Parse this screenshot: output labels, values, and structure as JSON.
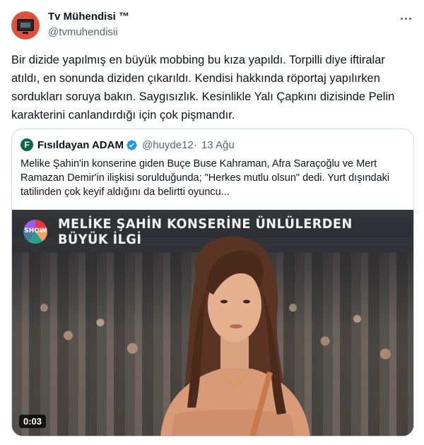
{
  "author": {
    "name": "Tv Mühendisi ™",
    "handle": "@tvmuhendisii",
    "avatar_icon": "tv-icon",
    "avatar_color": "#e0513d"
  },
  "tweet": {
    "text": "Bir dizide yapılmış en büyük mobbing bu kıza yapıldı. Torpilli diye iftiralar atıldı, en sonunda diziden çıkarıldı. Kendisi hakkında röportaj yapılırken sordukları soruya bakın. Saygısızlık. Kesinlikle Yalı Çapkını dizisinde Pelin karakterini canlandırdığı için çok pişmandır."
  },
  "quote": {
    "name": "Fısıldayan ADAM",
    "handle": "@huyde12",
    "separator": "·",
    "date": "13 Ağu",
    "verified": true,
    "verified_color": "#1d9bf0",
    "avatar_letter": "F",
    "text": "Melike Şahin'in konserine giden Buçe Buse Kahraman, Afra Saraçoğlu ve Mert Ramazan Demir'in ilişkisi sorulduğunda; \"Herkes mutlu olsun\" dedi. Yurt dışındaki tatilinden çok keyif aldığını da belirtti oyuncu..."
  },
  "video": {
    "banner": "MELİKE ŞAHİN KONSERİNE ÜNLÜLERDEN BÜYÜK İLGİ",
    "channel_logo": "SHOW",
    "duration": "0:03"
  }
}
